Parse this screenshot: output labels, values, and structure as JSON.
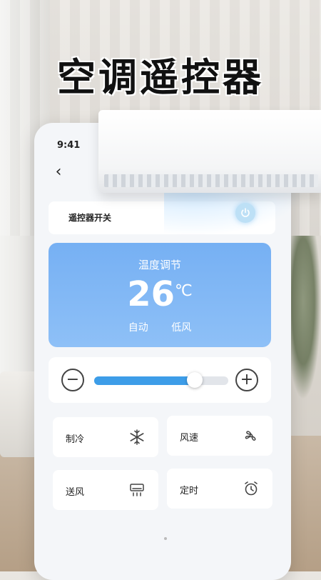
{
  "hero": {
    "title": "空调遥控器"
  },
  "status_bar": {
    "time": "9:41"
  },
  "nav": {
    "back_icon": "chevron-left-icon"
  },
  "power": {
    "label": "遥控器开关",
    "icon": "power-icon",
    "color": "#bde0f6"
  },
  "temperature": {
    "title": "温度调节",
    "value": "26",
    "unit": "℃",
    "mode": "自动",
    "fan": "低风",
    "card_color": "#7fb6f5"
  },
  "slider": {
    "minus_icon": "minus-icon",
    "plus_icon": "plus-icon",
    "level": 0.75,
    "fill_color": "#3d9de8"
  },
  "functions": [
    {
      "label": "制冷",
      "icon": "snowflake-icon"
    },
    {
      "label": "风速",
      "icon": "fan-icon"
    },
    {
      "label": "送风",
      "icon": "air-vent-icon"
    },
    {
      "label": "定时",
      "icon": "alarm-clock-icon"
    }
  ]
}
